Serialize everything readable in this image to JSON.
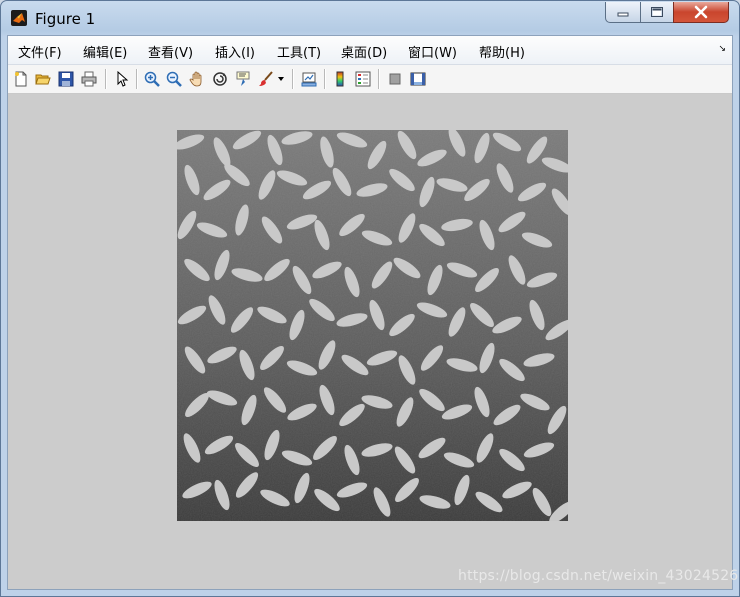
{
  "window": {
    "title": "Figure 1",
    "controls": [
      "minimize-icon",
      "maximize-icon",
      "close-icon"
    ]
  },
  "menubar": {
    "items": [
      {
        "label": "文件(F)"
      },
      {
        "label": "编辑(E)"
      },
      {
        "label": "查看(V)"
      },
      {
        "label": "插入(I)"
      },
      {
        "label": "工具(T)"
      },
      {
        "label": "桌面(D)"
      },
      {
        "label": "窗口(W)"
      },
      {
        "label": "帮助(H)"
      }
    ]
  },
  "toolbar": {
    "buttons": [
      "new-figure-icon",
      "open-file-icon",
      "save-icon",
      "print-icon",
      "edit-plot-arrow-icon",
      "zoom-in-icon",
      "zoom-out-icon",
      "pan-hand-icon",
      "rotate-3d-icon",
      "data-cursor-icon",
      "brush-icon",
      "brush-dropdown-icon",
      "link-plot-icon",
      "insert-colorbar-icon",
      "insert-legend-icon",
      "hide-plot-tools-icon",
      "show-plot-tools-icon"
    ]
  },
  "figure": {
    "image_description": "grayscale image of rice grains on a dark textured background"
  },
  "watermark": {
    "text": "https://blog.csdn.net/weixin_43024526"
  },
  "colors": {
    "figure_background": "#cccccc",
    "grain": "#c8c8c8",
    "background_dark": "#3a3a3a",
    "background_light": "#7a7a7a"
  }
}
